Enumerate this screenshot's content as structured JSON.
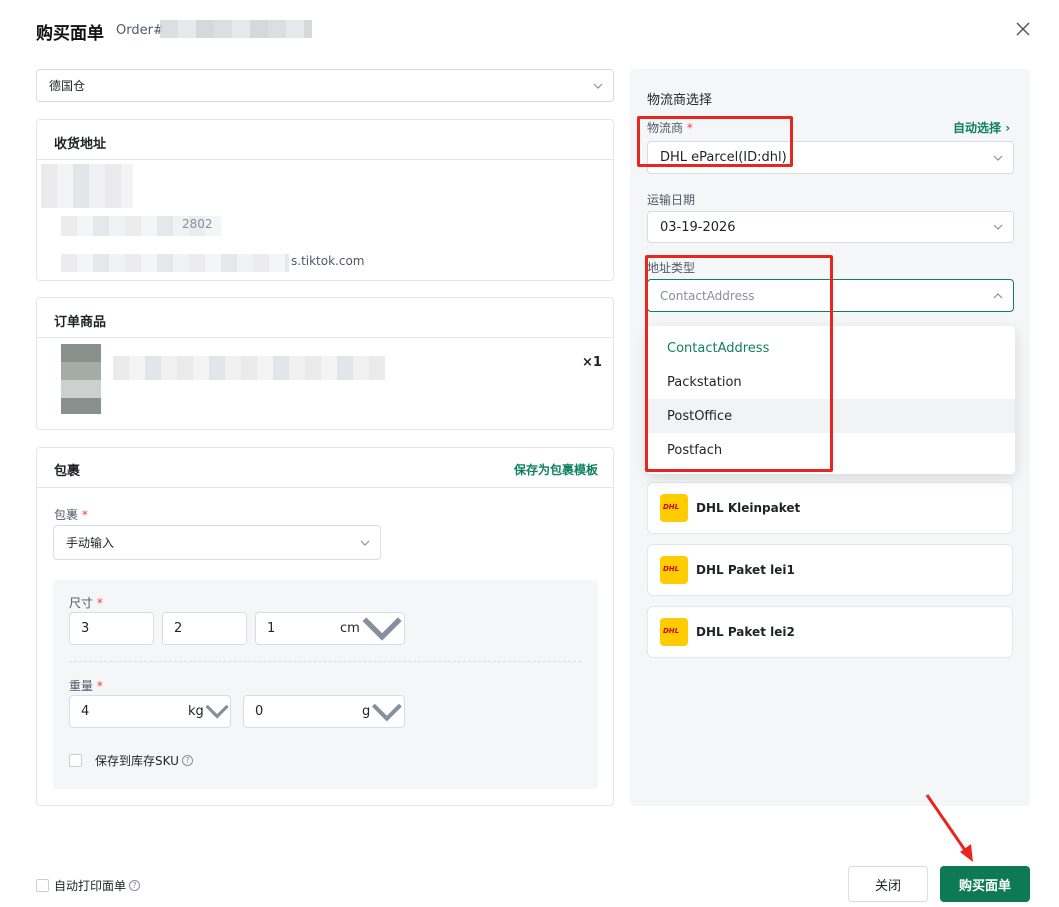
{
  "header": {
    "title": "购买面单",
    "order_prefix": "Order#"
  },
  "warehouse": {
    "value": "德国仓"
  },
  "shipping_address": {
    "title": "收货地址",
    "partial_phone": "2802",
    "partial_email": "s.tiktok.com"
  },
  "order_items": {
    "title": "订单商品",
    "quantity": "×1"
  },
  "package": {
    "title": "包裹",
    "save_template_label": "保存为包裹模板",
    "package_label": "包裹",
    "package_mode": "手动输入",
    "size_label": "尺寸",
    "length": "3",
    "width": "2",
    "height": "1",
    "size_unit": "cm",
    "weight_label": "重量",
    "weight_kg": "4",
    "weight_kg_unit": "kg",
    "weight_g": "0",
    "weight_g_unit": "g",
    "save_sku_label": "保存到库存SKU"
  },
  "logistics": {
    "title": "物流商选择",
    "carrier_label": "物流商",
    "auto_select_label": "自动选择",
    "carrier_value": "DHL eParcel(ID:dhl)",
    "ship_date_label": "运输日期",
    "ship_date_value": "03-19-2026",
    "address_type_label": "地址类型",
    "address_type_placeholder": "ContactAddress",
    "address_type_options": [
      "ContactAddress",
      "Packstation",
      "PostOffice",
      "Postfach"
    ],
    "selected_option_index": 0,
    "hovered_option_index": 2,
    "services": [
      {
        "name": "DHL Kleinpaket",
        "logo": "dhl-logo"
      },
      {
        "name": "DHL Paket lei1",
        "logo": "dhl-logo"
      },
      {
        "name": "DHL Paket lei2",
        "logo": "dhl-logo"
      }
    ],
    "dhl_logo_text": "DHL"
  },
  "footer": {
    "auto_print_label": "自动打印面单",
    "close_label": "关闭",
    "buy_label": "购买面单"
  },
  "colors": {
    "accent": "#10805f",
    "buy_button": "#0d7a55",
    "required": "#f53f3f",
    "highlight_box": "#e8261f",
    "panel_bg": "#f5f6f7",
    "dhl_yellow": "#ffcc00",
    "dhl_red": "#d40511"
  }
}
